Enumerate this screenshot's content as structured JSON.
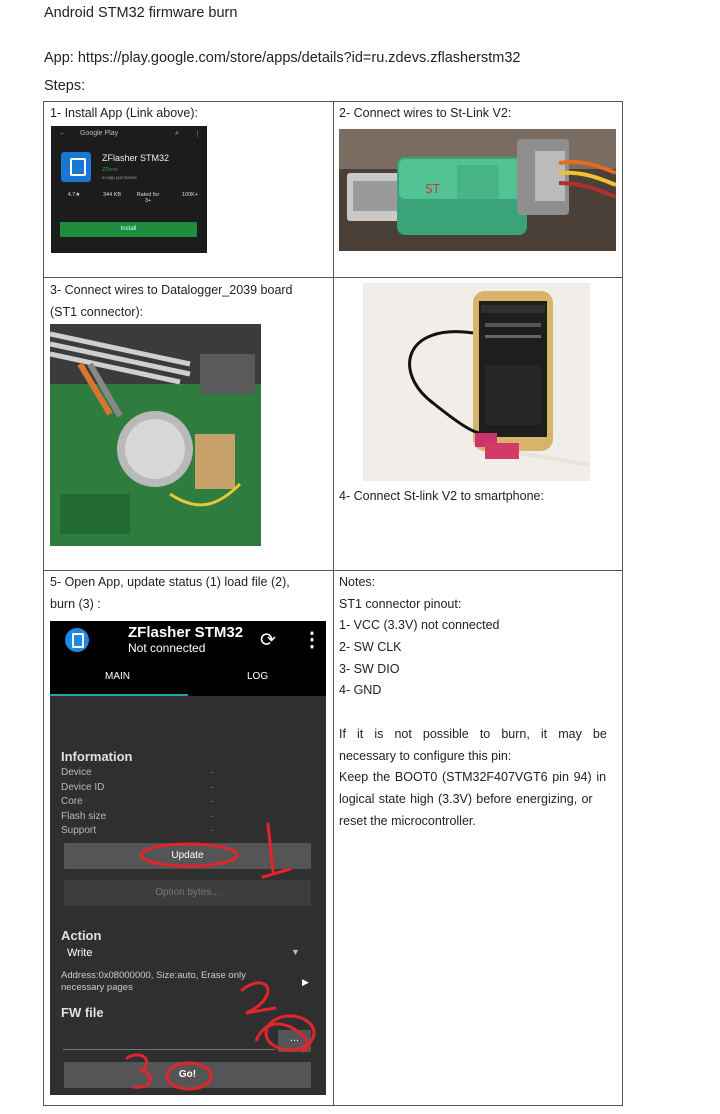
{
  "document": {
    "title": "Android STM32 firmware burn",
    "app_line": "App: https://play.google.com/store/apps/details?id=ru.zdevs.zflasherstm32",
    "steps_label": "Steps:"
  },
  "cells": {
    "step1": "1- Install App (Link above):",
    "step2": "2- Connect wires to St-Link V2:",
    "step3_line1": "3- Connect wires to Datalogger_2039 board",
    "step3_line2": "(ST1 connector):",
    "step4": "4- Connect St-link V2 to smartphone:",
    "step5_line1": "5- Open App, update status (1) load file (2),",
    "step5_line2": "burn (3) :",
    "notes": {
      "heading": "Notes:",
      "pinout_title": "ST1 connector pinout:",
      "pins": [
        "1- VCC (3.3V) not connected",
        "2- SW CLK",
        "3- SW DIO",
        "4- GND"
      ],
      "para1_l1": "If it is not possible to burn, it may be",
      "para1_l2": "necessary to configure this pin:",
      "para2_l1": "Keep the BOOT0 (STM32F407VGT6 pin 94) in",
      "para2_l2": "logical state high (3.3V) before energizing, or",
      "para2_l3": "reset the microcontroller."
    }
  },
  "play_store": {
    "header": "Google Play",
    "app_name": "ZFlasher STM32",
    "developer": "ZDevs",
    "iap": "In-app purchases",
    "stats": [
      "4.7★",
      "344 KB",
      "Rated for 3+",
      "100K+"
    ],
    "install_label": "Install"
  },
  "app_screen": {
    "title": "ZFlasher STM32",
    "status": "Not connected",
    "tabs": [
      "MAIN",
      "LOG"
    ],
    "information_heading": "Information",
    "info_fields": [
      "Device",
      "Device ID",
      "Core",
      "Flash size",
      "Support"
    ],
    "info_dash": "-",
    "update_label": "Update",
    "option_bytes_label": "Option bytes...",
    "action_heading": "Action",
    "action_value": "Write",
    "address_text": "Address:0x08000000, Size:auto, Erase only necessary pages",
    "fw_heading": "FW file",
    "browse_label": "...",
    "go_label": "Go!",
    "annotations": [
      "1",
      "2",
      "3"
    ]
  },
  "colors": {
    "app_bg": "#2f2f2f",
    "accent_tab": "#26a69a",
    "annotation_red": "#e0262b",
    "play_green": "#1e8e3e"
  }
}
